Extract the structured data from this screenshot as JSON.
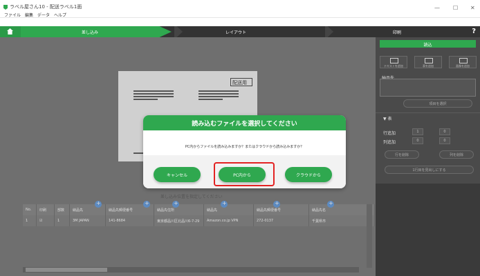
{
  "window": {
    "title": "ラベル屋さん10 - 配送ラベル1面",
    "minimize": "—",
    "maximize": "☐",
    "close": "✕"
  },
  "menu": [
    "ファイル",
    "編集",
    "データ",
    "ヘルプ"
  ],
  "steps": {
    "step1": "差し込み",
    "step2": "レイアウト",
    "step3": "印刷",
    "help": "?"
  },
  "right_panel": {
    "green_button": "読込",
    "tool_buttons": [
      "テキストを追加",
      "表を追加",
      "画像を追加"
    ],
    "item_label": "納品先",
    "select_button": "項目を選択",
    "filter_label": "▼ 表",
    "row_label_1": "行追加",
    "row_label_2": "列追加",
    "mini_values": [
      "1",
      "0",
      "0",
      "0"
    ],
    "pill_left_1": "行を削除",
    "pill_right_1": "列を削除",
    "pill_full": "1行目を見出しにする"
  },
  "preview": {
    "title": "配送用"
  },
  "hint_text": "差し込み位置を指定してください",
  "table": {
    "headers": [
      "No.",
      "印刷",
      "部数",
      "納品先",
      "納品先郵便番号",
      "納品先住所",
      "納品先",
      "納品先郵便番号",
      "納品先名"
    ],
    "rows": [
      [
        "1",
        "☑",
        "1",
        "3M JAPAN",
        "141-8684",
        "東京都品川区北品川6-7-29",
        "Amazon.co.jp VPN",
        "272-0137",
        "千葉県市"
      ]
    ]
  },
  "modal": {
    "title": "読み込むファイルを選択してください",
    "message": "PC内からファイルを読み込みますか？またはクラウドから読み込みますか？",
    "cancel_button": "キャンセル",
    "pc_button": "PC内から",
    "cloud_button": "クラウドから"
  },
  "colors": {
    "accent": "#2fa84f",
    "highlight": "#e32222"
  }
}
